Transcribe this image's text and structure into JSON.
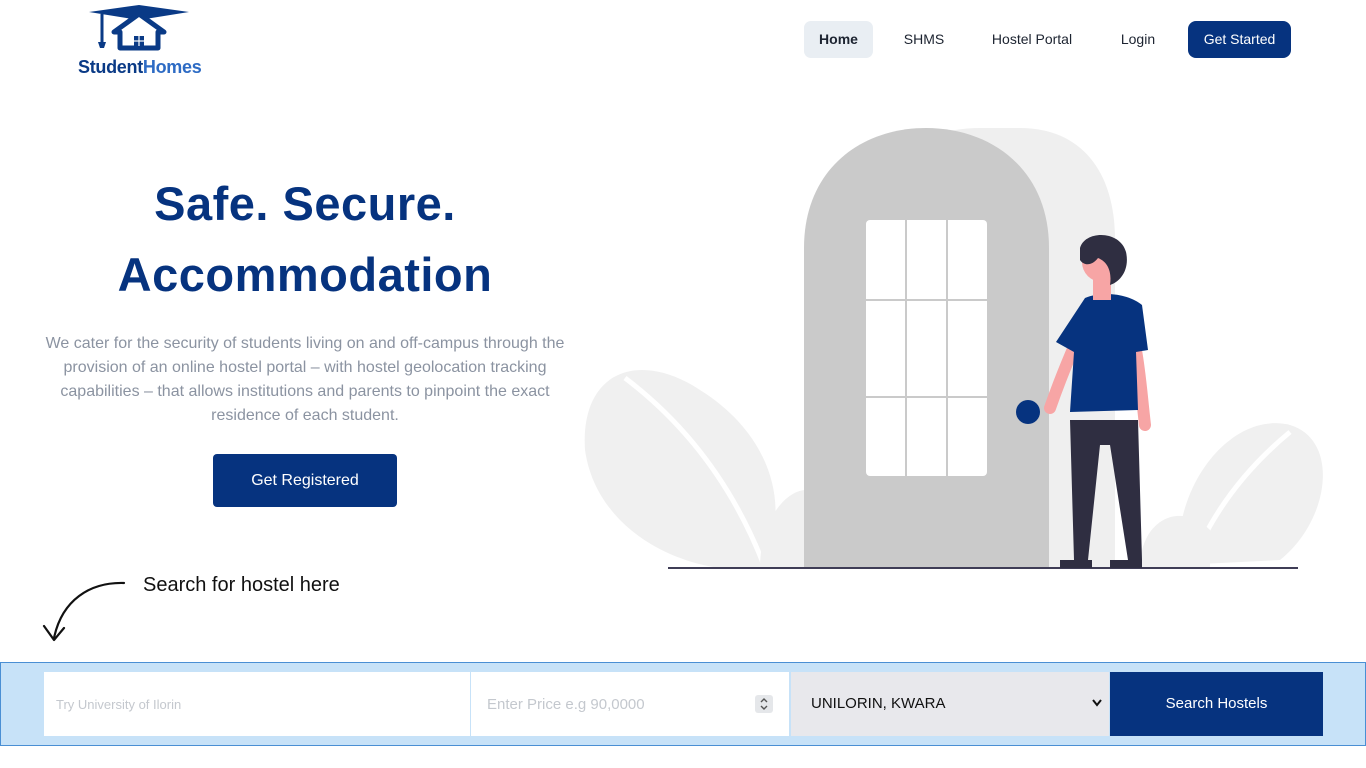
{
  "brand": {
    "name_part1": "Student",
    "name_part2": "Homes"
  },
  "nav": {
    "home": "Home",
    "shms": "SHMS",
    "hostel_portal": "Hostel Portal",
    "login": "Login",
    "get_started": "Get Started"
  },
  "hero": {
    "title_line1": "Safe. Secure.",
    "title_line2": "Accommodation",
    "description": "We cater for the security of students living on and off-campus through the provision of an online hostel portal – with hostel geolocation tracking capabilities – that allows institutions and parents to pinpoint the exact residence of each student.",
    "cta": "Get Registered"
  },
  "search_hint": "Search for hostel here",
  "search": {
    "query_placeholder": "Try University of Ilorin",
    "price_placeholder": "Enter Price e.g 90,0000",
    "location_selected": "UNILORIN, KWARA",
    "button": "Search Hostels"
  },
  "colors": {
    "primary": "#06337f",
    "search_bar_bg": "#c7e2f8",
    "nav_active_bg": "#e9eef3"
  },
  "icons": [
    "graduation-cap-house-icon",
    "curved-arrow-icon",
    "number-stepper-icon",
    "chevron-down-icon"
  ]
}
